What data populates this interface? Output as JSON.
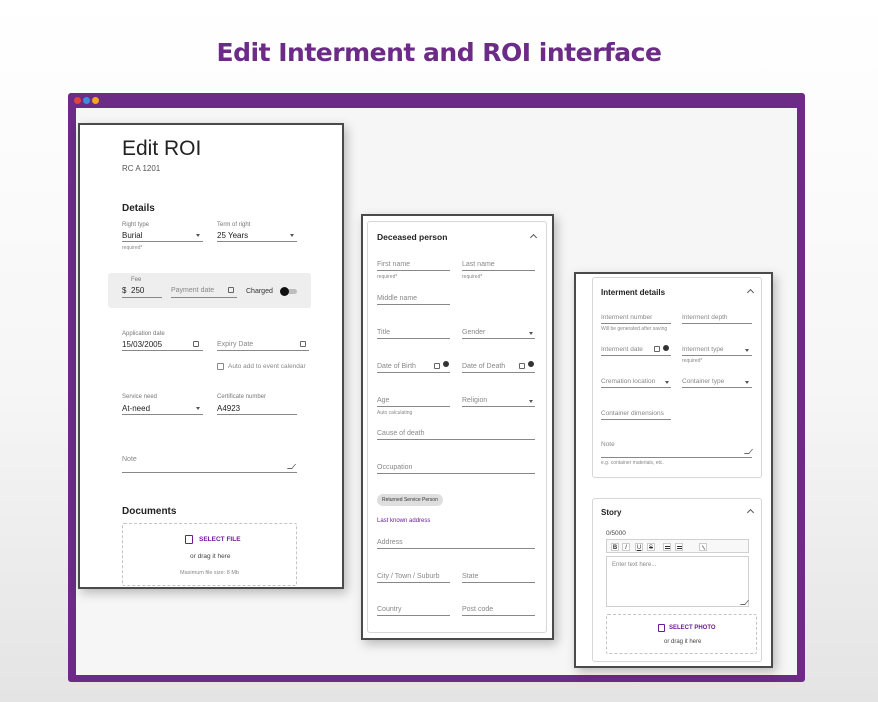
{
  "headline": "Edit Interment and ROI interface",
  "colors": {
    "brand": "#6b2b86",
    "accent": "#6a1b9a"
  },
  "roi": {
    "title": "Edit ROI",
    "subtitle": "RC A 1201",
    "details_heading": "Details",
    "right_type": {
      "label": "Right type",
      "value": "Burial",
      "helper": "required*"
    },
    "term_of_right": {
      "label": "Term of right",
      "value": "25 Years"
    },
    "fee": {
      "label": "Fee",
      "currency": "$",
      "value": "250"
    },
    "payment_date": {
      "placeholder": "Payment date"
    },
    "charged_label": "Charged",
    "application_date": {
      "label": "Application date",
      "value": "15/03/2005"
    },
    "expiry_date": {
      "placeholder": "Expiry Date"
    },
    "auto_add_label": "Auto add to event calendar",
    "service_need": {
      "label": "Service need",
      "value": "At-need"
    },
    "certificate_number": {
      "label": "Certificate number",
      "value": "A4923"
    },
    "note_placeholder": "Note",
    "documents_heading": "Documents",
    "select_file": "SELECT FILE",
    "drag_text": "or drag it here",
    "max_size": "Maximum file size: 8 Mb"
  },
  "deceased": {
    "title": "Deceased person",
    "first_name": "First name",
    "first_name_helper": "required*",
    "last_name": "Last name",
    "last_name_helper": "required*",
    "middle_name": "Middle name",
    "title_field": "Title",
    "gender": "Gender",
    "dob": "Date of Birth",
    "dod": "Date of Death",
    "age": "Age",
    "age_helper": "Auto calculating",
    "religion": "Religion",
    "cause_of_death": "Cause of death",
    "occupation": "Occupation",
    "chip": "Returned Service Person",
    "last_known_address": "Last known address",
    "address": "Address",
    "city": "City / Town / Suburb",
    "state": "State",
    "country": "Country",
    "post_code": "Post code"
  },
  "interment": {
    "title": "Interment details",
    "number": "Interment number",
    "number_helper": "Will be generated after saving",
    "depth": "Interment depth",
    "date": "Interment date",
    "type": "Interment type",
    "type_helper": "required*",
    "cremation_location": "Cremation location",
    "container_type": "Container type",
    "container_dimensions": "Container dimensions",
    "note": "Note",
    "note_helper": "e.g. container materials, etc.",
    "story_title": "Story",
    "counter": "0/5000",
    "toolbar": [
      "B",
      "I",
      "U",
      "S"
    ],
    "editor_placeholder": "Enter text here...",
    "select_photo": "SELECT PHOTO",
    "drag_text": "or drag it here"
  }
}
